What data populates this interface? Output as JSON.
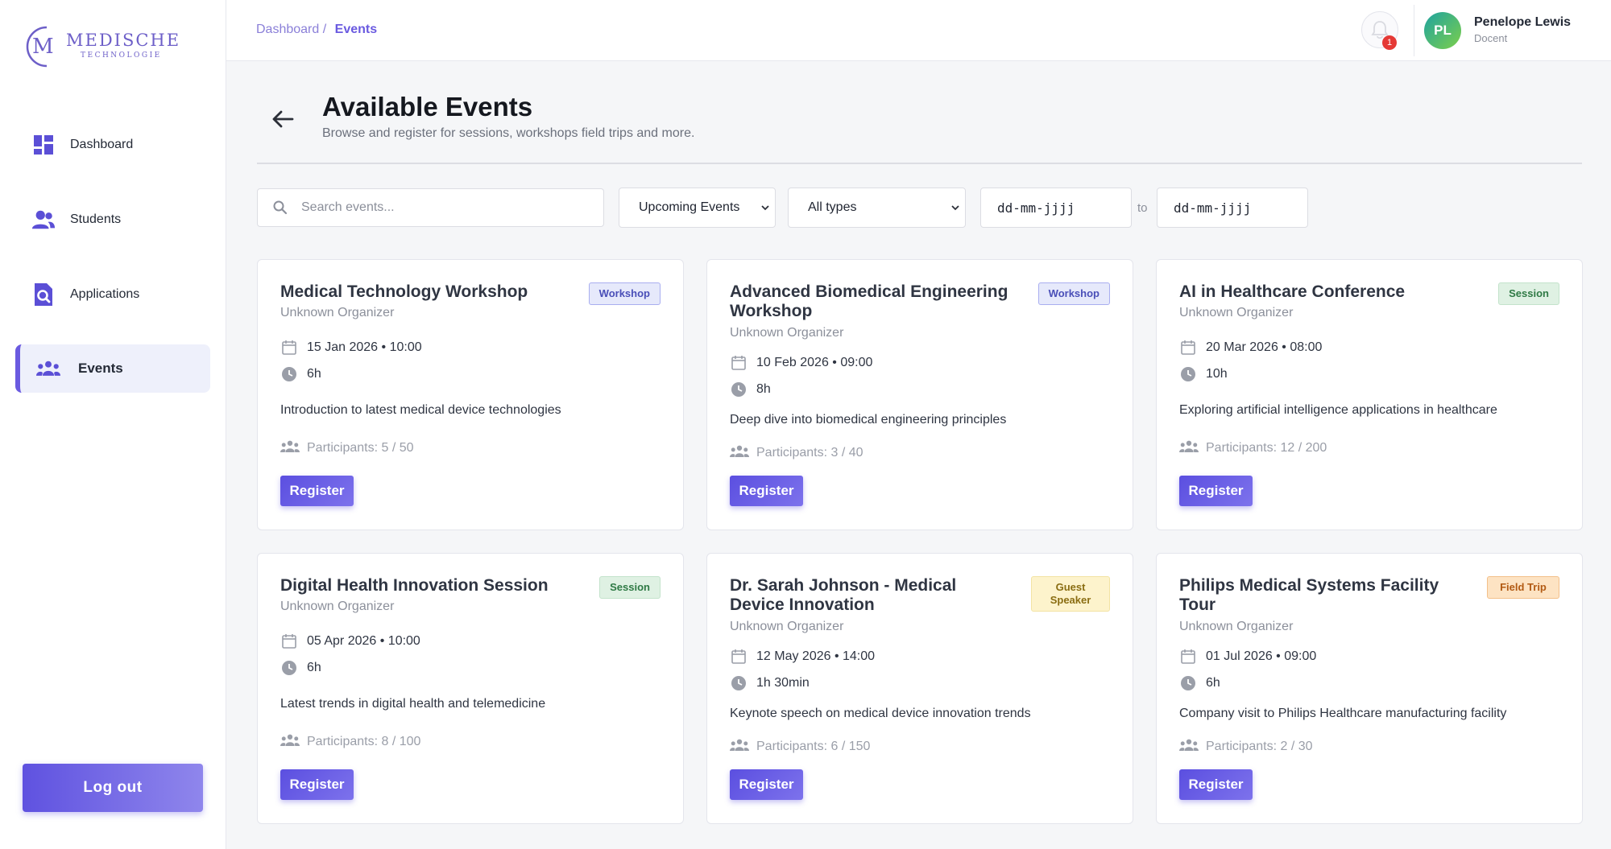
{
  "brand": {
    "word": "MEDISCHE",
    "sub": "TECHNOLOGIE"
  },
  "sidebar": {
    "items": [
      {
        "label": "Dashboard",
        "icon": "dashboard-icon"
      },
      {
        "label": "Students",
        "icon": "users-icon"
      },
      {
        "label": "Applications",
        "icon": "document-search-icon"
      },
      {
        "label": "Events",
        "icon": "people-group-icon",
        "active": true
      }
    ],
    "logout_label": "Log out"
  },
  "topbar": {
    "breadcrumb": {
      "root": "Dashboard",
      "separator": "/",
      "current": "Events"
    },
    "notifications_count": "1",
    "user": {
      "initials": "PL",
      "name": "Penelope Lewis",
      "role": "Docent"
    }
  },
  "page": {
    "title": "Available Events",
    "subtitle": "Browse and register for sessions, workshops field trips and more."
  },
  "filters": {
    "search_placeholder": "Search events...",
    "time_filter": "Upcoming Events",
    "type_filter": "All types",
    "date_from": "dd-mm-jjjj",
    "date_sep": "to",
    "date_to": "dd-mm-jjjj"
  },
  "events": [
    {
      "title": "Medical Technology Workshop",
      "type": "Workshop",
      "organizer": "Unknown Organizer",
      "datetime": "15 Jan 2026 • 10:00",
      "duration": "6h",
      "description": "Introduction to latest medical device technologies",
      "participants": "Participants: 5 / 50",
      "register_label": "Register"
    },
    {
      "title": "Advanced Biomedical Engineering Workshop",
      "type": "Workshop",
      "organizer": "Unknown Organizer",
      "datetime": "10 Feb 2026 • 09:00",
      "duration": "8h",
      "description": "Deep dive into biomedical engineering principles",
      "participants": "Participants: 3 / 40",
      "register_label": "Register"
    },
    {
      "title": "AI in Healthcare Conference",
      "type": "Session",
      "organizer": "Unknown Organizer",
      "datetime": "20 Mar 2026 • 08:00",
      "duration": "10h",
      "description": "Exploring artificial intelligence applications in healthcare",
      "participants": "Participants: 12 / 200",
      "register_label": "Register"
    },
    {
      "title": "Digital Health Innovation Session",
      "type": "Session",
      "organizer": "Unknown Organizer",
      "datetime": "05 Apr 2026 • 10:00",
      "duration": "6h",
      "description": "Latest trends in digital health and telemedicine",
      "participants": "Participants: 8 / 100",
      "register_label": "Register"
    },
    {
      "title": "Dr. Sarah Johnson - Medical Device Innovation",
      "type": "Guest Speaker",
      "organizer": "Unknown Organizer",
      "datetime": "12 May 2026 • 14:00",
      "duration": "1h 30min",
      "description": "Keynote speech on medical device innovation trends",
      "participants": "Participants: 6 / 150",
      "register_label": "Register"
    },
    {
      "title": "Philips Medical Systems Facility Tour",
      "type": "Field Trip",
      "organizer": "Unknown Organizer",
      "datetime": "01 Jul 2026 • 09:00",
      "duration": "6h",
      "description": "Company visit to Philips Healthcare manufacturing facility",
      "participants": "Participants: 2 / 30",
      "register_label": "Register"
    }
  ],
  "colors": {
    "accent": "#6a5ae0",
    "badge_red": "#e53935"
  }
}
